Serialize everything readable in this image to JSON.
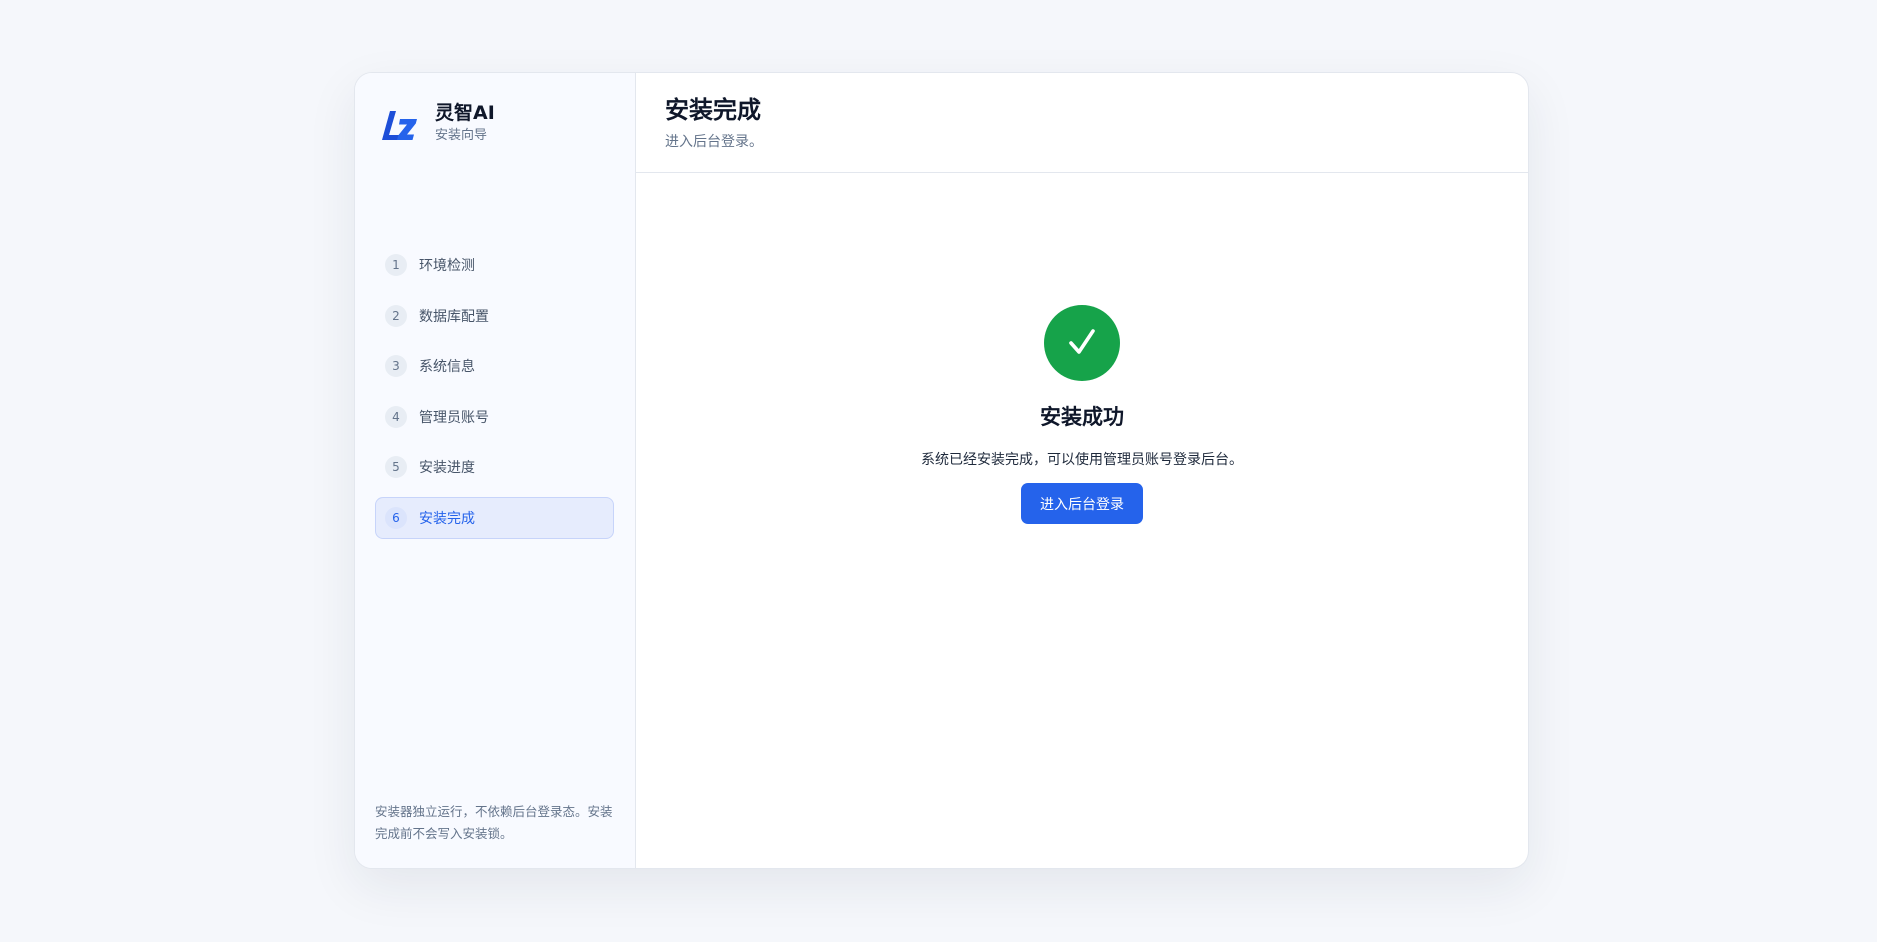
{
  "brand": {
    "name": "灵智AI",
    "subtitle": "安装向导",
    "icon": "lz-logo-icon",
    "color": "#1d4ed8"
  },
  "steps": [
    {
      "num": "1",
      "label": "环境检测"
    },
    {
      "num": "2",
      "label": "数据库配置"
    },
    {
      "num": "3",
      "label": "系统信息"
    },
    {
      "num": "4",
      "label": "管理员账号"
    },
    {
      "num": "5",
      "label": "安装进度"
    },
    {
      "num": "6",
      "label": "安装完成",
      "active": true
    }
  ],
  "sidebar": {
    "footnote": "安装器独立运行，不依赖后台登录态。安装完成前不会写入安装锁。"
  },
  "header": {
    "title": "安装完成",
    "subtitle": "进入后台登录。"
  },
  "success": {
    "icon": "check-icon",
    "heading": "安装成功",
    "description": "系统已经安装完成，可以使用管理员账号登录后台。",
    "button_label": "进入后台登录"
  },
  "colors": {
    "accent": "#2563eb",
    "success": "#16a34a"
  }
}
